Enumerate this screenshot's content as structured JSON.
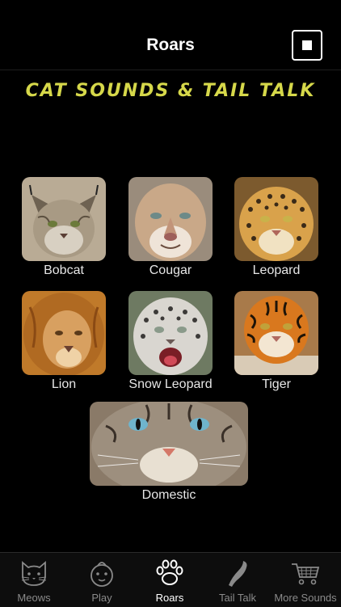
{
  "header": {
    "title": "Roars",
    "stop_icon": "stop-icon"
  },
  "banner": {
    "text": "Cat Sounds & Tail Talk",
    "color": "#d6d84a"
  },
  "cats": [
    {
      "id": "bobcat",
      "label": "Bobcat"
    },
    {
      "id": "cougar",
      "label": "Cougar"
    },
    {
      "id": "leopard",
      "label": "Leopard"
    },
    {
      "id": "lion",
      "label": "Lion"
    },
    {
      "id": "snow-leopard",
      "label": "Snow Leopard"
    },
    {
      "id": "tiger",
      "label": "Tiger"
    },
    {
      "id": "domestic",
      "label": "Domestic"
    }
  ],
  "tabs": [
    {
      "label": "Meows",
      "icon": "cat-face-icon"
    },
    {
      "label": "Play",
      "icon": "toy-icon"
    },
    {
      "label": "Roars",
      "icon": "paw-icon",
      "active": true
    },
    {
      "label": "Tail Talk",
      "icon": "tail-icon"
    },
    {
      "label": "More Sounds",
      "icon": "shopping-cart-icon"
    }
  ]
}
